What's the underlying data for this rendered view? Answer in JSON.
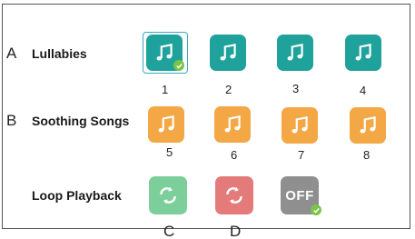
{
  "rows": {
    "lullabies": {
      "marker": "A",
      "label": "Lullabies",
      "tracks": [
        "1",
        "2",
        "3",
        "4"
      ],
      "selected_index": 0
    },
    "soothing": {
      "marker": "B",
      "label": "Soothing Songs",
      "tracks": [
        "5",
        "6",
        "7",
        "8"
      ]
    },
    "loop": {
      "label": "Loop Playback",
      "options": [
        {
          "marker": "C",
          "icon": "loop-green-icon"
        },
        {
          "marker": "D",
          "icon": "loop-red-icon"
        },
        {
          "text": "OFF",
          "icon": "off-icon",
          "checked": true
        }
      ]
    }
  },
  "colors": {
    "teal": "#1fa29c",
    "orange": "#f3a845",
    "loop_green": "#7ccf9a",
    "loop_red": "#e57a7a",
    "off_gray": "#8f8f8f",
    "check": "#7bc44a",
    "selection": "#3aa7c4"
  }
}
